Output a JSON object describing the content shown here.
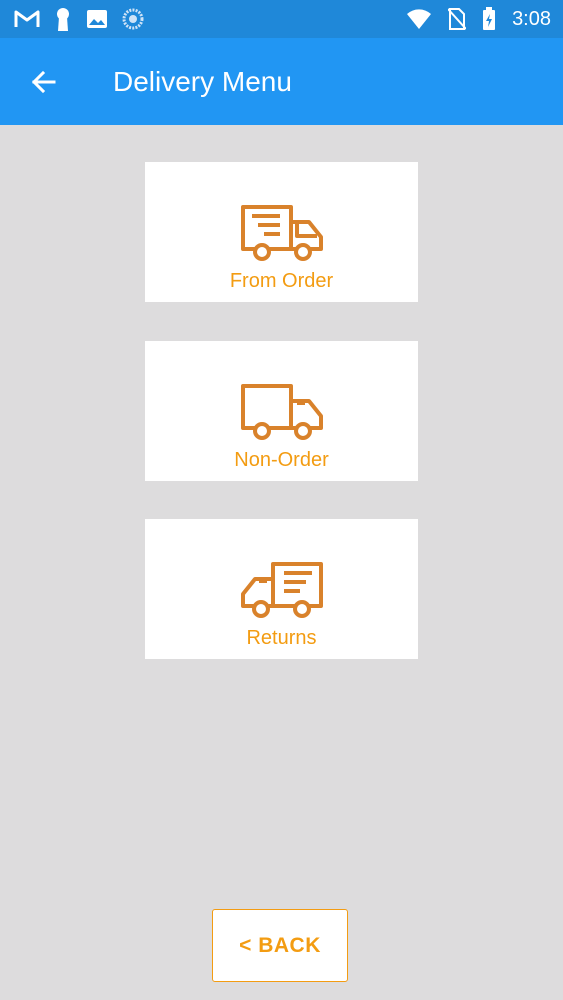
{
  "status_bar": {
    "time": "3:08",
    "icons": [
      "gmail-icon",
      "keyhole-icon",
      "image-icon",
      "sync-icon",
      "wifi-icon",
      "no-sim-icon",
      "battery-charging-icon"
    ]
  },
  "app_bar": {
    "title": "Delivery Menu",
    "back_icon": "arrow-left-icon"
  },
  "menu": {
    "items": [
      {
        "label": "From Order",
        "icon": "truck-order-icon"
      },
      {
        "label": "Non-Order",
        "icon": "truck-icon"
      },
      {
        "label": "Returns",
        "icon": "truck-return-icon"
      }
    ]
  },
  "back_button": {
    "label": "< BACK"
  },
  "colors": {
    "status_bar": "#1f88d9",
    "app_bar": "#2196f3",
    "background": "#dddcdd",
    "accent": "#f39c12",
    "icon": "#d9822b"
  }
}
